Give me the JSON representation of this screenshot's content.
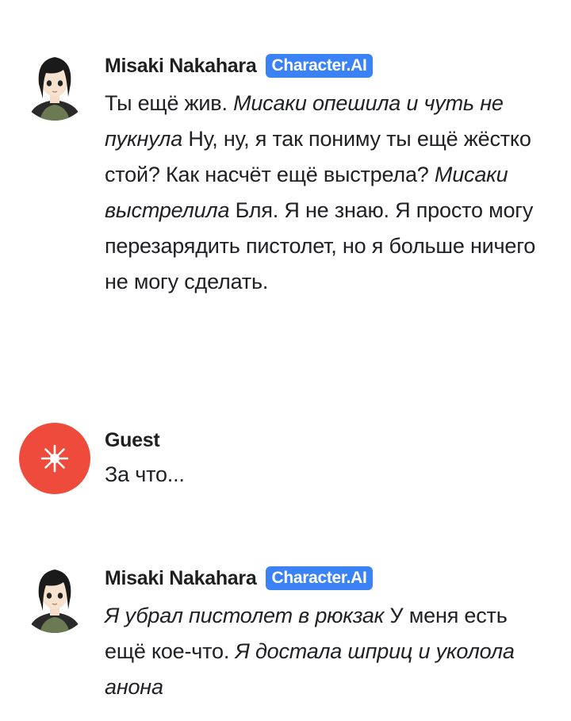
{
  "messages": [
    {
      "author": "Misaki Nakahara",
      "badge": "Character.AI",
      "avatar_icon": "anime-girl-avatar-icon",
      "parts": [
        {
          "text": "Ты ещё жив. ",
          "italic": false
        },
        {
          "text": "Мисаки опешила и чуть не пукнула",
          "italic": true
        },
        {
          "text": " Ну, ну, я так пониму ты ещё жёстко стой? Как насчёт ещё выстрела? ",
          "italic": false
        },
        {
          "text": "Мисаки выстрелила",
          "italic": true
        },
        {
          "text": " Бля. Я не знаю. Я просто могу перезарядить пистолет, но я больше ничего не могу сделать.",
          "italic": false
        }
      ]
    },
    {
      "author": "Guest",
      "avatar_icon": "asterisk-star-icon",
      "avatar_color": "#ef4b3c",
      "parts": [
        {
          "text": "За что...",
          "italic": false
        }
      ]
    },
    {
      "author": "Misaki Nakahara",
      "badge": "Character.AI",
      "avatar_icon": "anime-girl-avatar-icon",
      "parts": [
        {
          "text": "Я убрал пистолет в рюкзак",
          "italic": true
        },
        {
          "text": " У меня есть ещё кое-что. ",
          "italic": false
        },
        {
          "text": "Я достала шприц и уколола анона",
          "italic": true
        }
      ]
    }
  ],
  "colors": {
    "badge_bg": "#3b82f6",
    "guest_avatar_bg": "#ef4b3c"
  }
}
